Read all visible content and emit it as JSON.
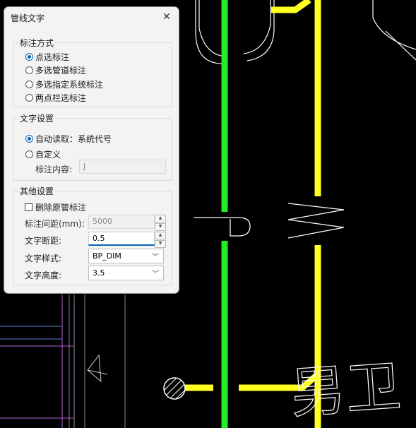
{
  "dialog": {
    "title": "管线文字",
    "close_glyph": "✕",
    "mark_method": {
      "title": "标注方式",
      "options": [
        {
          "label": "点选标注",
          "selected": true
        },
        {
          "label": "多选管道标注",
          "selected": false
        },
        {
          "label": "多选指定系统标注",
          "selected": false
        },
        {
          "label": "两点栏选标注",
          "selected": false
        }
      ]
    },
    "text_settings": {
      "title": "文字设置",
      "options": [
        {
          "label": "自动读取：系统代号",
          "selected": true
        },
        {
          "label": "自定义",
          "selected": false
        }
      ],
      "content_label": "标注内容:",
      "content_value": "J"
    },
    "other_settings": {
      "title": "其他设置",
      "delete_original_label": "删除原管标注",
      "delete_original_checked": false,
      "spacing_label": "标注间距(mm):",
      "spacing_value": "5000",
      "gap_label": "文字断距:",
      "gap_value": "0.5",
      "style_label": "文字样式:",
      "style_value": "BP_DIM",
      "height_label": "文字高度:",
      "height_value": "3.5"
    }
  },
  "drawing": {
    "text_glyphs": "男卫",
    "colors": {
      "pipe_green": "#22ee22",
      "pipe_yellow": "#ffff22",
      "line_white": "#ffffff",
      "line_purple": "#b060d0",
      "line_blue": "#5c80d0",
      "background": "#000000",
      "accent": "#0a64b4"
    }
  }
}
